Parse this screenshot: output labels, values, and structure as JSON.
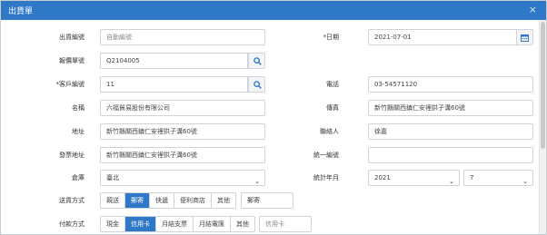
{
  "window": {
    "title": "出貨單",
    "close": "×"
  },
  "left": {
    "doc_no": {
      "label": "出貨編號",
      "placeholder": "自動編號"
    },
    "quote_no": {
      "label": "報價單號",
      "value": "Q2104005"
    },
    "customer_no": {
      "label": "*客戶編號",
      "value": "11"
    },
    "name": {
      "label": "名稱",
      "value": "六福貿易股份有限公司"
    },
    "address": {
      "label": "地址",
      "value": "新竹縣關西鎮仁安裡拱子溝60號"
    },
    "ship_address": {
      "label": "發票地址",
      "value": "新竹縣關西鎮仁安裡拱子溝60號"
    },
    "warehouse": {
      "label": "倉庫",
      "value": "臺北"
    },
    "delivery": {
      "label": "送貨方式",
      "options": [
        "親送",
        "郵寄",
        "快遞",
        "便利商店",
        "其他"
      ],
      "selected": "郵寄",
      "detail": "郵寄"
    },
    "payment": {
      "label": "付款方式",
      "options": [
        "現金",
        "信用卡",
        "月結支票",
        "月結電匯",
        "其他"
      ],
      "selected": "信用卡",
      "detail_placeholder": "信用卡"
    }
  },
  "right": {
    "date": {
      "label": "*日期",
      "value": "2021-07-01"
    },
    "phone": {
      "label": "電話",
      "value": "03-54571120"
    },
    "fax": {
      "label": "傳真",
      "value": "新竹縣關西鎮仁安裡拱子溝60號"
    },
    "contact": {
      "label": "聯絡人",
      "value": "徐嘉"
    },
    "tax_id": {
      "label": "統一編號",
      "value": ""
    },
    "stat_period": {
      "label": "統計年月",
      "year": "2021",
      "month": "7"
    }
  },
  "colors": {
    "accent": "#2f78c8",
    "border": "#ced4da"
  }
}
